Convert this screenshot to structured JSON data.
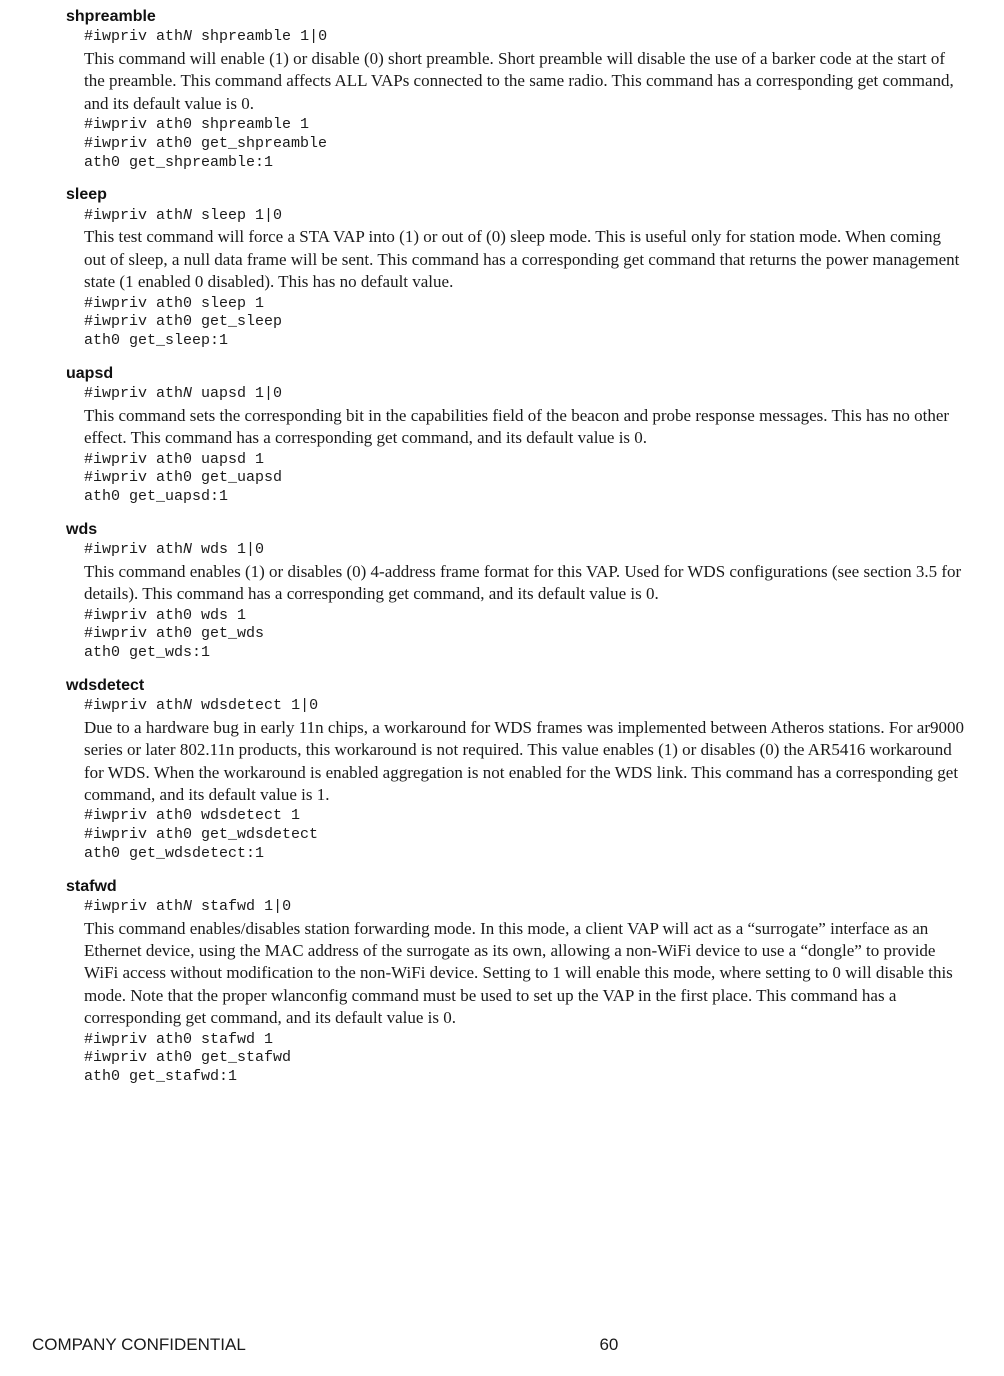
{
  "sections": [
    {
      "title": "shpreamble",
      "syntax_prefix": "#iwpriv ath",
      "syntax_n": "N",
      "syntax_suffix": " shpreamble 1|0",
      "desc": "This command will enable (1) or disable (0) short preamble. Short preamble will disable the use of a barker code at the start of the preamble. This command affects ALL VAPs connected to the same radio. This command has a corresponding get command, and its default value is 0.",
      "example": "#iwpriv ath0 shpreamble 1\n#iwpriv ath0 get_shpreamble\nath0 get_shpreamble:1"
    },
    {
      "title": "sleep",
      "syntax_prefix": "#iwpriv ath",
      "syntax_n": "N",
      "syntax_suffix": " sleep 1|0",
      "desc": "This test command will force a STA VAP into (1) or out of (0) sleep mode. This is useful only for station mode. When coming out of sleep, a null data frame will be sent. This command has a corresponding get command that returns the power management state (1 enabled 0 disabled). This has no default value.",
      "example": "#iwpriv ath0 sleep 1\n#iwpriv ath0 get_sleep\nath0 get_sleep:1"
    },
    {
      "title": "uapsd",
      "syntax_prefix": "#iwpriv ath",
      "syntax_n": "N",
      "syntax_suffix": " uapsd 1|0",
      "desc": "This command sets the corresponding bit in the capabilities field of the beacon and probe response messages. This has no other effect. This command has a corresponding get command, and its default value is 0.",
      "example": "#iwpriv ath0 uapsd 1\n#iwpriv ath0 get_uapsd\nath0 get_uapsd:1"
    },
    {
      "title": "wds",
      "syntax_prefix": "#iwpriv ath",
      "syntax_n": "N",
      "syntax_suffix": " wds 1|0",
      "desc": "This command enables (1) or disables (0) 4-address frame format for this VAP. Used for WDS configurations (see section 3.5 for details). This command has a corresponding get command, and its default value is 0.",
      "example": "#iwpriv ath0 wds 1\n#iwpriv ath0 get_wds\nath0 get_wds:1"
    },
    {
      "title": "wdsdetect",
      "syntax_prefix": "#iwpriv ath",
      "syntax_n": "N",
      "syntax_suffix": " wdsdetect 1|0",
      "desc": "Due to a hardware bug in early 11n chips, a workaround for WDS frames was implemented between Atheros stations. For ar9000 series or later 802.11n products, this workaround is not required. This value enables (1) or disables (0) the AR5416 workaround for WDS. When the workaround is enabled aggregation is not enabled for the WDS link. This command has a corresponding get command, and its default value is 1.",
      "example": "#iwpriv ath0 wdsdetect 1\n#iwpriv ath0 get_wdsdetect\nath0 get_wdsdetect:1"
    },
    {
      "title": "stafwd",
      "syntax_prefix": "#iwpriv ath",
      "syntax_n": "N",
      "syntax_suffix_pre": " stafwd ",
      "syntax_suffix_ital": "1|0",
      "desc": "This command enables/disables station forwarding mode. In this mode, a client VAP will act as a “surrogate” interface as an Ethernet device, using the MAC address of the surrogate as its own, allowing a non-WiFi device to use a “dongle” to provide WiFi access without modification to the non-WiFi device. Setting to 1 will enable this mode, where setting to 0 will disable this mode. Note that the proper wlanconfig command must be used to set up the VAP in the first place. This command has a corresponding get command, and its default value is 0.",
      "example": "#iwpriv ath0 stafwd 1\n#iwpriv ath0 get_stafwd\nath0 get_stafwd:1"
    }
  ],
  "footer": {
    "left": "COMPANY CONFIDENTIAL",
    "page": "60"
  }
}
